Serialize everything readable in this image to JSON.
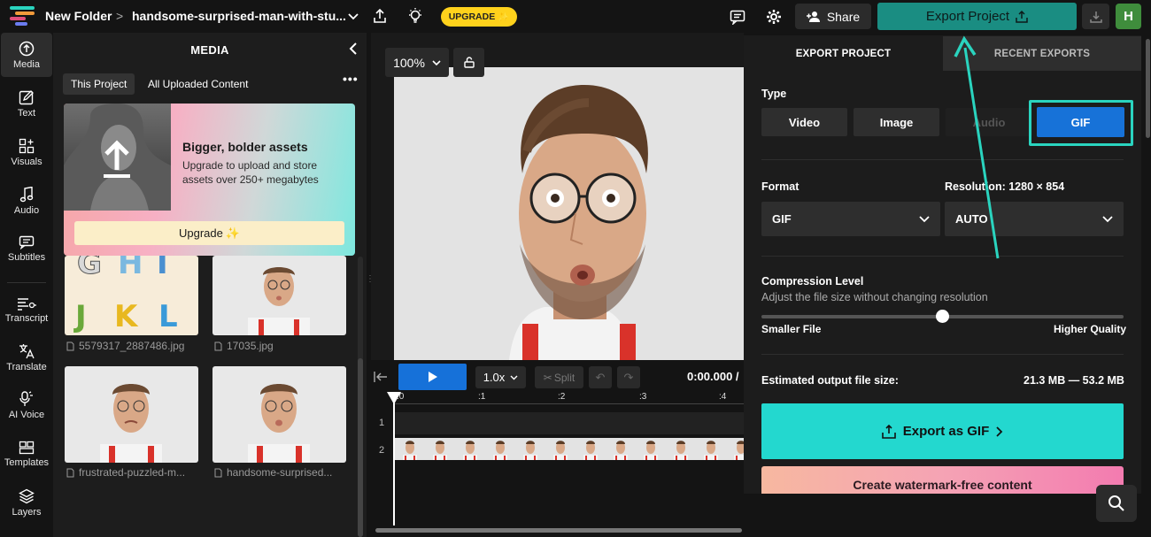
{
  "topbar": {
    "folder": "New Folder",
    "breadcrumb_sep": ">",
    "project_name": "handsome-surprised-man-with-stu...",
    "upgrade_label": "UPGRADE",
    "upgrade_sparkle": "✨",
    "share_label": "Share",
    "export_label": "Export Project",
    "avatar_initial": "H"
  },
  "sidebar": {
    "items": [
      {
        "label": "Media",
        "icon": "upload-icon"
      },
      {
        "label": "Text",
        "icon": "edit-icon"
      },
      {
        "label": "Visuals",
        "icon": "shapes-icon"
      },
      {
        "label": "Audio",
        "icon": "music-note-icon"
      },
      {
        "label": "Subtitles",
        "icon": "subtitles-icon"
      },
      {
        "label": "Transcript",
        "icon": "transcript-icon"
      },
      {
        "label": "Translate",
        "icon": "translate-icon"
      },
      {
        "label": "AI Voice",
        "icon": "ai-voice-icon"
      },
      {
        "label": "Templates",
        "icon": "templates-icon"
      },
      {
        "label": "Layers",
        "icon": "layers-icon"
      }
    ]
  },
  "media": {
    "title": "MEDIA",
    "tabs": [
      "This Project",
      "All Uploaded Content"
    ],
    "promo": {
      "title": "Bigger, bolder assets",
      "description": "Upgrade to upload and store assets over 250+ megabytes",
      "button_label": "Upgrade",
      "button_sparkle": "✨"
    },
    "files": [
      {
        "name": "5579317_2887486.jpg"
      },
      {
        "name": "17035.jpg"
      },
      {
        "name": "frustrated-puzzled-m..."
      },
      {
        "name": "handsome-surprised..."
      }
    ]
  },
  "canvas": {
    "zoom": "100%"
  },
  "timeline": {
    "speed": "1.0x",
    "split_label": "Split",
    "timecode": "0:00.000 /",
    "ruler": [
      ":0",
      ":1",
      ":2",
      ":3",
      ":4"
    ],
    "track_numbers": [
      "1",
      "2"
    ]
  },
  "export_panel": {
    "tabs": [
      "EXPORT PROJECT",
      "RECENT EXPORTS"
    ],
    "type_label": "Type",
    "types": [
      "Video",
      "Image",
      "Audio",
      "GIF"
    ],
    "selected_type": "GIF",
    "format_label": "Format",
    "format_value": "GIF",
    "resolution_label": "Resolution:",
    "resolution_value": "1280 × 854",
    "resolution_select": "AUTO",
    "compression_label": "Compression Level",
    "compression_desc": "Adjust the file size without changing resolution",
    "compression_level": 0.5,
    "slider_min_label": "Smaller File",
    "slider_max_label": "Higher Quality",
    "estimate_label": "Estimated output file size:",
    "estimate_value": "21.3 MB — 53.2 MB",
    "export_gif_label": "Export as GIF",
    "watermark_label": "Create watermark-free content"
  },
  "colors": {
    "accent_teal": "#1a8d82",
    "highlight_teal": "#2ad4bf",
    "gif_blue": "#1772d8",
    "upgrade_yellow": "#ffd21c",
    "export_cta": "#23d8cf"
  }
}
